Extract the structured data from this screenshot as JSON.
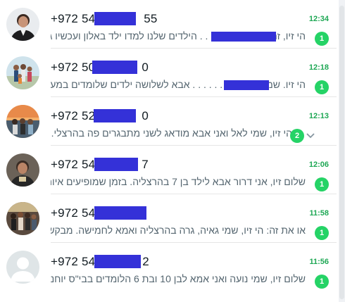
{
  "colors": {
    "accent": "#1fa855",
    "badge": "#25d366",
    "redaction": "#3431d8",
    "preview_text": "#54656f",
    "title_text": "#111b21"
  },
  "chats": [
    {
      "phone": "+972 54-",
      "phone_tail": "55",
      "time": "12:34",
      "preview": "הי זיו, זה . . . . . . . . . . . . . הילדים שלנו למדו ילד באלון ועכשיו גם ...",
      "unread": "1",
      "avatar_icon": "profile-photo-icon"
    },
    {
      "phone": "+972 50",
      "phone_tail": "0",
      "time": "12:18",
      "preview": "הי זיו. שמי . . . . . . . . . . . . . אבא לשלושה ילדים שלומדים במערכת ...",
      "unread": "1",
      "avatar_icon": "profile-photo-icon"
    },
    {
      "phone": "+972 52",
      "phone_tail": "0",
      "time": "12:13",
      "preview": "הי זיו, שמי לאל ואני אבא מודאג לשני מתבגרים פה בהרצלי...",
      "unread": "2",
      "avatar_icon": "profile-photo-icon",
      "chevron": "chevron-down-icon"
    },
    {
      "phone": "+972 54-",
      "phone_tail": "7",
      "time": "12:06",
      "preview": "שלום זיו, אני דרור אבא לילד בן 7 בהרצליה. בזמן שמופיעים איום...",
      "unread": "1",
      "avatar_icon": "profile-photo-icon"
    },
    {
      "phone": "+972 54-",
      "phone_tail": "",
      "time": "11:58",
      "preview": "או את זה: הי זיו, שמי גאיה, גרה בהרצליה ואמא לחמישה. מבקש...",
      "unread": "1",
      "avatar_icon": "profile-photo-icon"
    },
    {
      "phone": "+972 54-",
      "phone_tail": "2",
      "time": "11:56",
      "preview": "שלום זיו, שמי נועה ואני אמא לבן 10 ובת 6 הלומדים בבי\"ס יוחנני...",
      "unread": "1",
      "avatar_icon": "default-avatar-icon"
    }
  ]
}
